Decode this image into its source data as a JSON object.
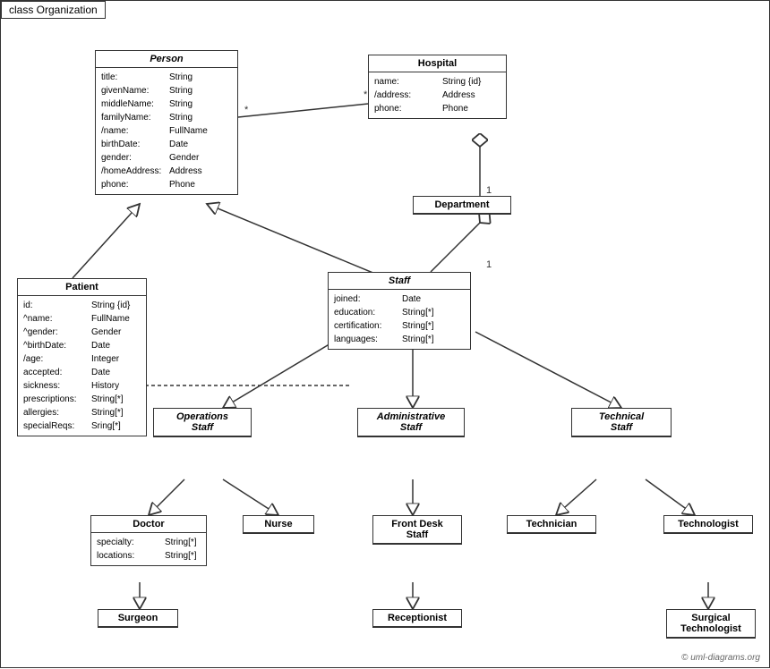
{
  "diagram": {
    "title": "class Organization",
    "copyright": "© uml-diagrams.org",
    "classes": {
      "person": {
        "name": "Person",
        "italic": true,
        "fields": [
          {
            "field": "title:",
            "type": "String"
          },
          {
            "field": "givenName:",
            "type": "String"
          },
          {
            "field": "middleName:",
            "type": "String"
          },
          {
            "field": "familyName:",
            "type": "String"
          },
          {
            "field": "/name:",
            "type": "FullName"
          },
          {
            "field": "birthDate:",
            "type": "Date"
          },
          {
            "field": "gender:",
            "type": "Gender"
          },
          {
            "field": "/homeAddress:",
            "type": "Address"
          },
          {
            "field": "phone:",
            "type": "Phone"
          }
        ]
      },
      "hospital": {
        "name": "Hospital",
        "italic": false,
        "fields": [
          {
            "field": "name:",
            "type": "String {id}"
          },
          {
            "field": "/address:",
            "type": "Address"
          },
          {
            "field": "phone:",
            "type": "Phone"
          }
        ]
      },
      "department": {
        "name": "Department",
        "italic": false,
        "fields": []
      },
      "staff": {
        "name": "Staff",
        "italic": true,
        "fields": [
          {
            "field": "joined:",
            "type": "Date"
          },
          {
            "field": "education:",
            "type": "String[*]"
          },
          {
            "field": "certification:",
            "type": "String[*]"
          },
          {
            "field": "languages:",
            "type": "String[*]"
          }
        ]
      },
      "patient": {
        "name": "Patient",
        "italic": false,
        "fields": [
          {
            "field": "id:",
            "type": "String {id}"
          },
          {
            "field": "^name:",
            "type": "FullName"
          },
          {
            "field": "^gender:",
            "type": "Gender"
          },
          {
            "field": "^birthDate:",
            "type": "Date"
          },
          {
            "field": "/age:",
            "type": "Integer"
          },
          {
            "field": "accepted:",
            "type": "Date"
          },
          {
            "field": "sickness:",
            "type": "History"
          },
          {
            "field": "prescriptions:",
            "type": "String[*]"
          },
          {
            "field": "allergies:",
            "type": "String[*]"
          },
          {
            "field": "specialReqs:",
            "type": "Sring[*]"
          }
        ]
      },
      "operations_staff": {
        "name": "Operations\nStaff",
        "italic": true,
        "fields": []
      },
      "administrative_staff": {
        "name": "Administrative\nStaff",
        "italic": true,
        "fields": []
      },
      "technical_staff": {
        "name": "Technical\nStaff",
        "italic": true,
        "fields": []
      },
      "doctor": {
        "name": "Doctor",
        "italic": false,
        "fields": [
          {
            "field": "specialty:",
            "type": "String[*]"
          },
          {
            "field": "locations:",
            "type": "String[*]"
          }
        ]
      },
      "nurse": {
        "name": "Nurse",
        "italic": false,
        "fields": []
      },
      "front_desk_staff": {
        "name": "Front Desk\nStaff",
        "italic": false,
        "fields": []
      },
      "technician": {
        "name": "Technician",
        "italic": false,
        "fields": []
      },
      "technologist": {
        "name": "Technologist",
        "italic": false,
        "fields": []
      },
      "surgeon": {
        "name": "Surgeon",
        "italic": false,
        "fields": []
      },
      "receptionist": {
        "name": "Receptionist",
        "italic": false,
        "fields": []
      },
      "surgical_technologist": {
        "name": "Surgical\nTechnologist",
        "italic": false,
        "fields": []
      }
    }
  }
}
